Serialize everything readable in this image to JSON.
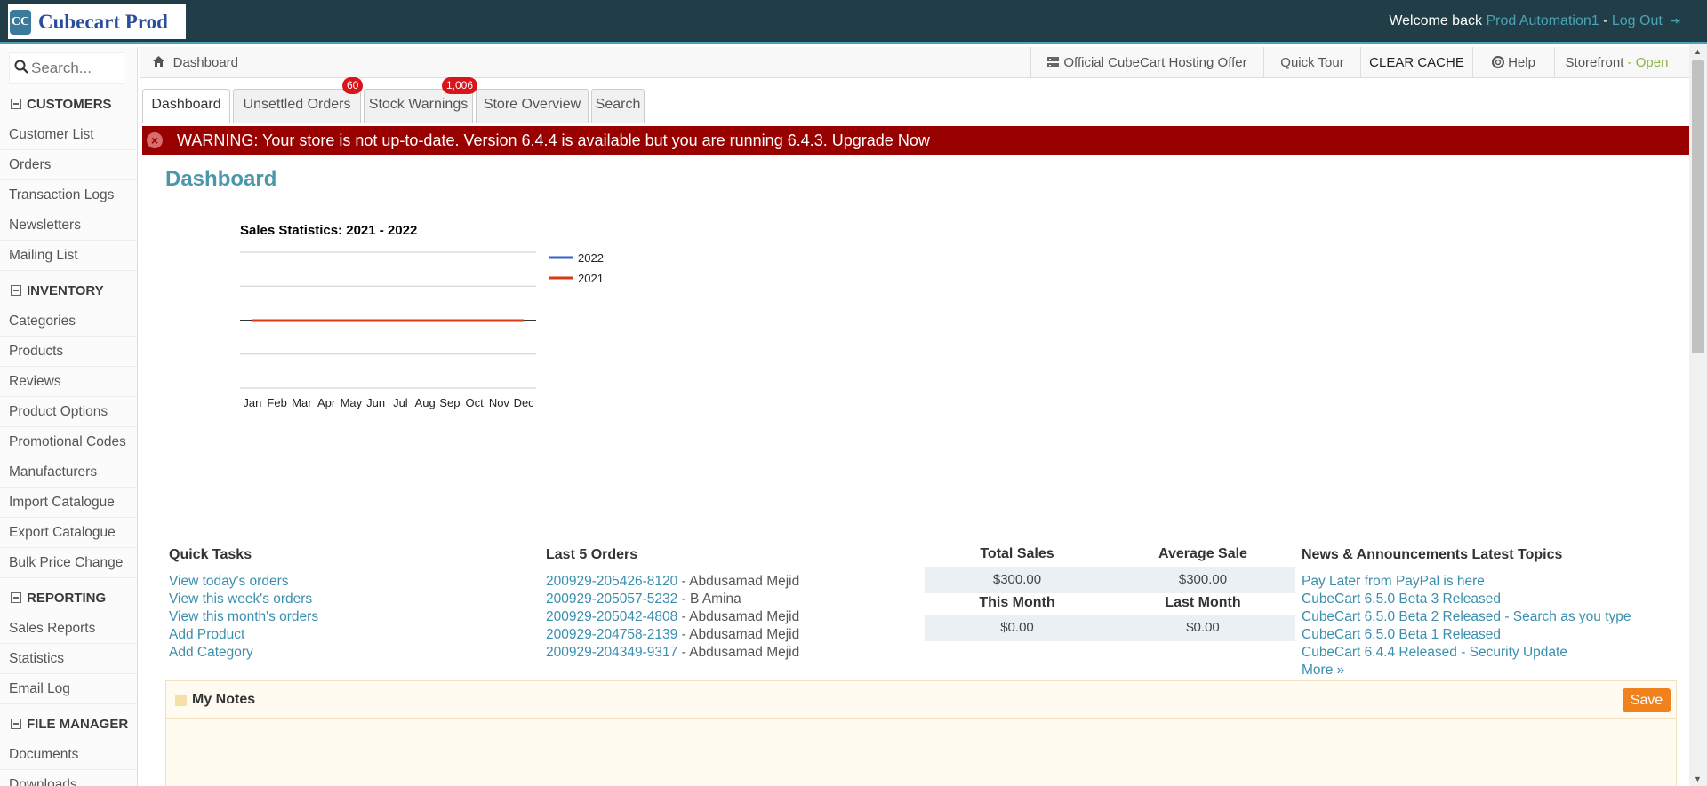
{
  "app": {
    "logo_mark": "CC",
    "logo_text": "Cubecart Prod",
    "welcome_prefix": "Welcome back",
    "user_name": "Prod Automation1",
    "separator": "-",
    "logout_label": "Log Out"
  },
  "sidebar": {
    "search_placeholder": "Search...",
    "sections": [
      {
        "label": "CUSTOMERS",
        "items": [
          "Customer List",
          "Orders",
          "Transaction Logs",
          "Newsletters",
          "Mailing List"
        ]
      },
      {
        "label": "INVENTORY",
        "items": [
          "Categories",
          "Products",
          "Reviews",
          "Product Options",
          "Promotional Codes",
          "Manufacturers",
          "Import Catalogue",
          "Export Catalogue",
          "Bulk Price Change"
        ]
      },
      {
        "label": "REPORTING",
        "items": [
          "Sales Reports",
          "Statistics",
          "Email Log"
        ]
      },
      {
        "label": "FILE MANAGER",
        "items": [
          "Documents",
          "Downloads"
        ]
      }
    ]
  },
  "breadcrumb": "Dashboard",
  "top_buttons": {
    "hosting": "Official CubeCart Hosting Offer",
    "tour": "Quick Tour",
    "cache": "CLEAR CACHE",
    "help": "Help",
    "storefront": "Storefront",
    "storefront_sep": "-",
    "storefront_status": "Open"
  },
  "tabs": [
    {
      "label": "Dashboard",
      "badge": ""
    },
    {
      "label": "Unsettled Orders",
      "badge": "60"
    },
    {
      "label": "Stock Warnings",
      "badge": "1,006"
    },
    {
      "label": "Store Overview",
      "badge": ""
    },
    {
      "label": "Search",
      "badge": ""
    }
  ],
  "warning": {
    "text": "WARNING: Your store is not up-to-date. Version 6.4.4 is available but you are running 6.4.3.",
    "link": "Upgrade Now"
  },
  "page_title": "Dashboard",
  "chart_data": {
    "type": "line",
    "title": "Sales Statistics: 2021 - 2022",
    "categories": [
      "Jan",
      "Feb",
      "Mar",
      "Apr",
      "May",
      "Jun",
      "Jul",
      "Aug",
      "Sep",
      "Oct",
      "Nov",
      "Dec"
    ],
    "series": [
      {
        "name": "2022",
        "color": "#3366cc",
        "values": [
          0,
          0,
          0,
          0,
          0,
          0,
          0,
          0,
          0,
          0,
          0,
          0
        ]
      },
      {
        "name": "2021",
        "color": "#dc3912",
        "values": [
          0,
          0,
          0,
          0,
          0,
          0,
          0,
          0,
          0,
          0,
          0,
          0
        ]
      }
    ],
    "legend": "right",
    "grid": true
  },
  "quick_tasks": {
    "heading": "Quick Tasks",
    "links": [
      "View today's orders",
      "View this week's orders",
      "View this month's orders",
      "Add Product",
      "Add Category"
    ]
  },
  "last_orders": {
    "heading": "Last 5 Orders",
    "orders": [
      {
        "id": "200929-205426-8120",
        "customer": "- Abdusamad Mejid"
      },
      {
        "id": "200929-205057-5232",
        "customer": "- B Amina"
      },
      {
        "id": "200929-205042-4808",
        "customer": "- Abdusamad Mejid"
      },
      {
        "id": "200929-204758-2139",
        "customer": "- Abdusamad Mejid"
      },
      {
        "id": "200929-204349-9317",
        "customer": "- Abdusamad Mejid"
      }
    ]
  },
  "stats": {
    "total_sales_label": "Total Sales",
    "total_sales": "$300.00",
    "average_sale_label": "Average Sale",
    "average_sale": "$300.00",
    "this_month_label": "This Month",
    "this_month": "$0.00",
    "last_month_label": "Last Month",
    "last_month": "$0.00"
  },
  "news": {
    "heading": "News & Announcements Latest Topics",
    "items": [
      "Pay Later from PayPal is here",
      "CubeCart 6.5.0 Beta 3 Released",
      "CubeCart 6.5.0 Beta 2 Released - Search as you type",
      "CubeCart 6.5.0 Beta 1 Released",
      "CubeCart 6.4.4 Released - Security Update"
    ],
    "more": "More »"
  },
  "notes": {
    "title": "My Notes",
    "save": "Save"
  }
}
